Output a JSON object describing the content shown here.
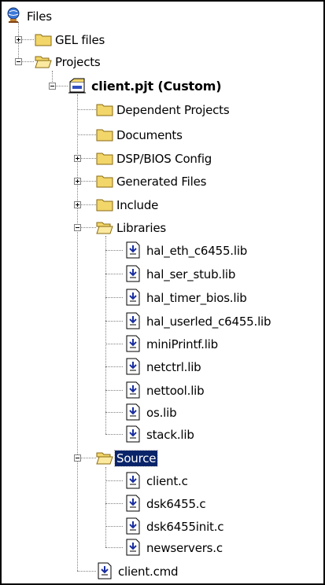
{
  "tree": {
    "root": {
      "label": "Files",
      "icon": "globe-icon"
    },
    "gel_files": {
      "label": "GEL files",
      "icon": "folder-icon"
    },
    "projects": {
      "label": "Projects",
      "icon": "folder-open-icon"
    },
    "project": {
      "label": "client.pjt (Custom)",
      "icon": "project-icon"
    },
    "project_children": [
      {
        "label": "Dependent Projects",
        "icon": "folder-icon"
      },
      {
        "label": "Documents",
        "icon": "folder-icon"
      },
      {
        "label": "DSP/BIOS Config",
        "icon": "folder-icon"
      },
      {
        "label": "Generated Files",
        "icon": "folder-icon"
      },
      {
        "label": "Include",
        "icon": "folder-icon"
      },
      {
        "label": "Libraries",
        "icon": "folder-open-icon"
      }
    ],
    "libraries": [
      "hal_eth_c6455.lib",
      "hal_ser_stub.lib",
      "hal_timer_bios.lib",
      "hal_userled_c6455.lib",
      "miniPrintf.lib",
      "netctrl.lib",
      "nettool.lib",
      "os.lib",
      "stack.lib"
    ],
    "source": {
      "label": "Source",
      "icon": "folder-open-icon"
    },
    "source_files": [
      "client.c",
      "dsk6455.c",
      "dsk6455init.c",
      "newservers.c"
    ],
    "cmd_file": {
      "label": "client.cmd",
      "icon": "file-icon"
    }
  },
  "colors": {
    "selection": "#0a246a",
    "folder": "#f2d66a",
    "tree_lines": "#808080"
  }
}
